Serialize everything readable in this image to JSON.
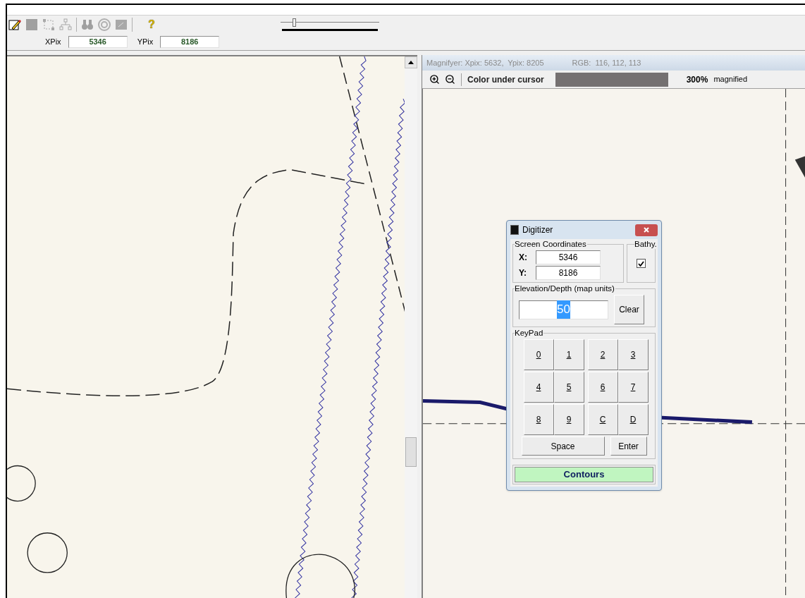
{
  "toolbar": {
    "help_glyph": "?",
    "slider": {
      "level": 0.12
    }
  },
  "coordinates": [
    {
      "label": "XPix",
      "value": "5346"
    },
    {
      "label": "YPix",
      "value": "8186"
    }
  ],
  "magnifier": {
    "info": "Magnifyer: Xpix: 5632,  Ypix: 8205",
    "rgb": "RGB:  116, 112, 113",
    "color_label": "Color under cursor",
    "swatch": {
      "color": "#747071"
    },
    "zoom": "300%",
    "zoom_label": "magnified"
  },
  "digitizer": {
    "title": "Digitizer",
    "screen_coordinates": {
      "label": "Screen Coordinates",
      "fields": [
        {
          "label": "X:",
          "value": "5346"
        },
        {
          "label": "Y:",
          "value": "8186"
        }
      ]
    },
    "bathy": {
      "label": "Bathy.",
      "checked": true
    },
    "elevation": {
      "label": "Elevation/Depth (map units)",
      "value": "50",
      "text_selected": true,
      "clear": "Clear"
    },
    "keypad": {
      "label": "KeyPad",
      "keys": [
        "0",
        "1",
        "2",
        "3",
        "4",
        "5",
        "6",
        "7",
        "8",
        "9",
        "C",
        "D"
      ],
      "space": "Space",
      "enter": "Enter"
    },
    "status": "Contours"
  }
}
